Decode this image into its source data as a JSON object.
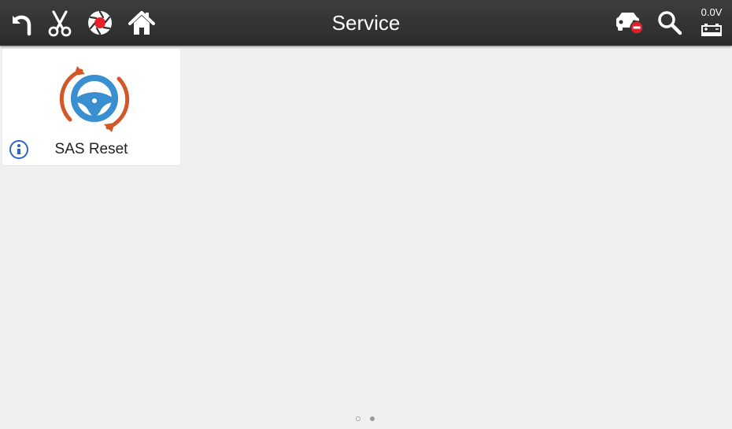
{
  "header": {
    "title": "Service",
    "battery_voltage": "0.0V",
    "icons": {
      "back": "back-arrow-icon",
      "cut": "scissors-icon",
      "record": "record-shutter-icon",
      "home": "home-icon",
      "vehicle": "vehicle-disconnected-icon",
      "search": "search-icon",
      "battery": "battery-icon"
    }
  },
  "functions": [
    {
      "label": "SAS Reset",
      "icon": "steering-wheel-reset-icon",
      "info_icon": "info-icon"
    }
  ],
  "pagination": {
    "pages": 2,
    "current_page": 2
  },
  "colors": {
    "toolbar": "#333333",
    "background": "#f0f0f0",
    "wheel_blue": "#3a8fd0",
    "arrow_orange": "#d2582a",
    "record_red": "#e8202a",
    "status_red": "#e0202a",
    "info_blue": "#2f64c4"
  }
}
